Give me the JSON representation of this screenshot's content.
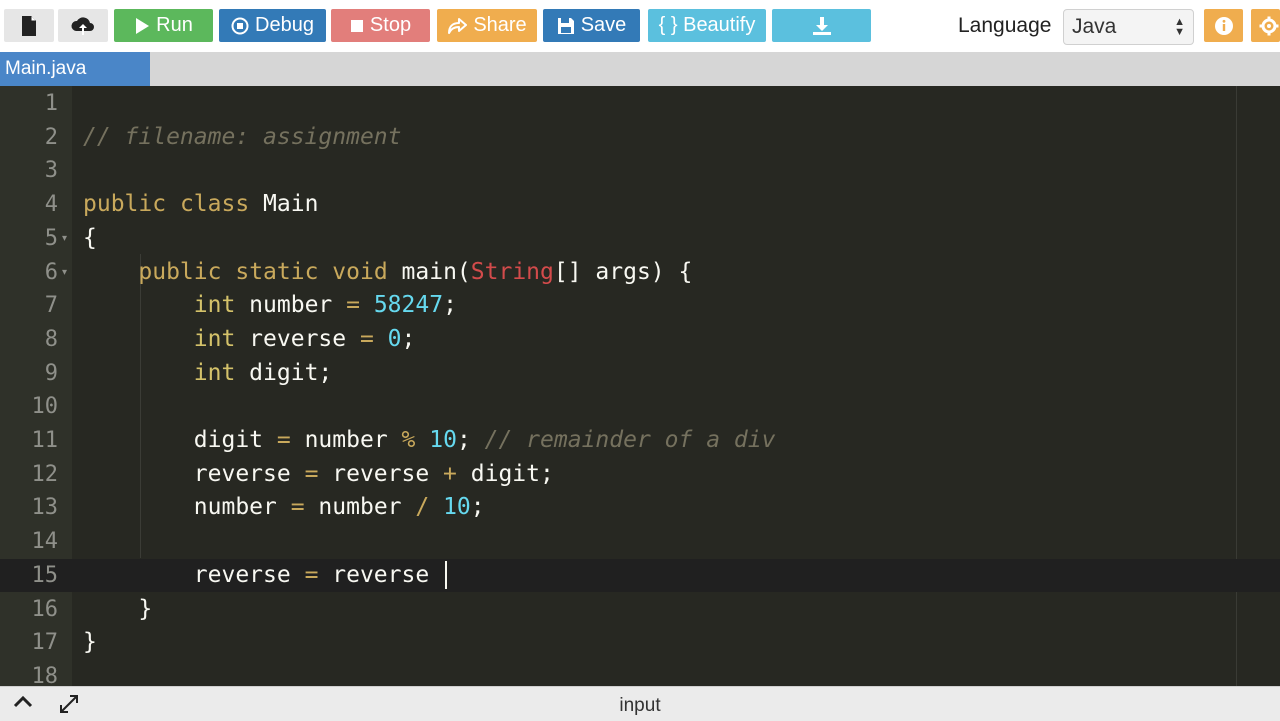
{
  "toolbar": {
    "buttons": [
      {
        "id": "new",
        "label": "",
        "icon": "file-icon"
      },
      {
        "id": "upload",
        "label": "",
        "icon": "cloud-upload-icon"
      },
      {
        "id": "run",
        "label": "Run",
        "icon": "play-icon",
        "color": "#5cb85c"
      },
      {
        "id": "debug",
        "label": "Debug",
        "icon": "debug-icon",
        "color": "#337ab7"
      },
      {
        "id": "stop",
        "label": "Stop",
        "icon": "stop-icon",
        "color": "#d9534f"
      },
      {
        "id": "share",
        "label": "Share",
        "icon": "share-icon",
        "color": "#f0ad4e"
      },
      {
        "id": "save",
        "label": "Save",
        "icon": "floppy-icon",
        "color": "#337ab7"
      },
      {
        "id": "beautify",
        "label": "{ } Beautify",
        "icon": "",
        "color": "#5bc0de"
      },
      {
        "id": "download",
        "label": "",
        "icon": "download-icon",
        "color": "#5bc0de"
      }
    ],
    "language_label": "Language",
    "language_value": "Java"
  },
  "tabs": [
    {
      "label": "Main.java"
    }
  ],
  "editor": {
    "lines": [
      {
        "n": "1",
        "text": ""
      },
      {
        "n": "2",
        "text": "// filename: assignment"
      },
      {
        "n": "3",
        "text": ""
      },
      {
        "n": "4",
        "text": "public class Main"
      },
      {
        "n": "5",
        "text": "{"
      },
      {
        "n": "6",
        "text": "    public static void main(String[] args) {"
      },
      {
        "n": "7",
        "text": "        int number = 58247;"
      },
      {
        "n": "8",
        "text": "        int reverse = 0;"
      },
      {
        "n": "9",
        "text": "        int digit;"
      },
      {
        "n": "10",
        "text": ""
      },
      {
        "n": "11",
        "text": "        digit = number % 10; // remainder of a div"
      },
      {
        "n": "12",
        "text": "        reverse = reverse + digit;"
      },
      {
        "n": "13",
        "text": "        number = number / 10;"
      },
      {
        "n": "14",
        "text": ""
      },
      {
        "n": "15",
        "text": "        reverse = reverse "
      },
      {
        "n": "16",
        "text": "    }"
      },
      {
        "n": "17",
        "text": "}"
      },
      {
        "n": "18",
        "text": ""
      }
    ]
  },
  "bottom": {
    "label": "input"
  }
}
